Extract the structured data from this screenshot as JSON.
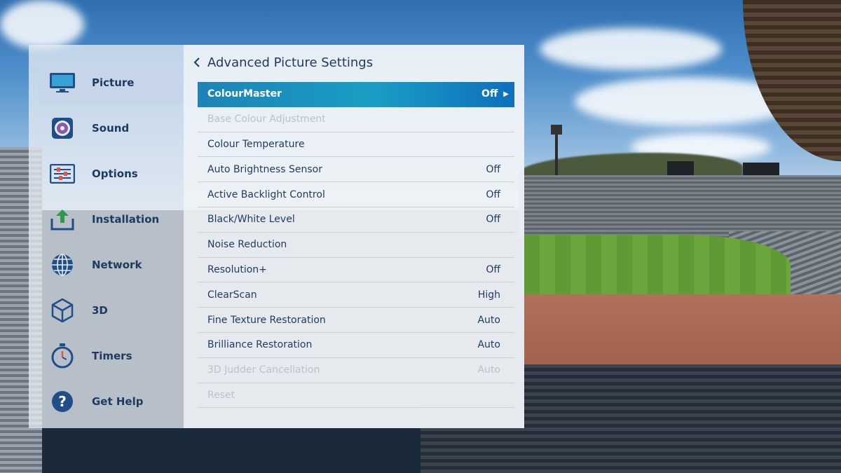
{
  "sidebar": {
    "items": [
      {
        "label": "Picture",
        "icon": "tv-icon",
        "selected": true
      },
      {
        "label": "Sound",
        "icon": "speaker-icon",
        "selected": false
      },
      {
        "label": "Options",
        "icon": "options-icon",
        "selected": false
      },
      {
        "label": "Installation",
        "icon": "installation-icon",
        "selected": false
      },
      {
        "label": "Network",
        "icon": "globe-icon",
        "selected": false
      },
      {
        "label": "3D",
        "icon": "cube-icon",
        "selected": false
      },
      {
        "label": "Timers",
        "icon": "stopwatch-icon",
        "selected": false
      },
      {
        "label": "Get Help",
        "icon": "help-icon",
        "selected": false
      }
    ]
  },
  "header": {
    "back_icon": "chevron-left-icon",
    "title": "Advanced Picture Settings"
  },
  "settings": [
    {
      "label": "ColourMaster",
      "value": "Off",
      "state": "selected"
    },
    {
      "label": "Base Colour Adjustment",
      "value": "",
      "state": "disabled"
    },
    {
      "label": "Colour Temperature",
      "value": "",
      "state": "normal"
    },
    {
      "label": "Auto Brightness Sensor",
      "value": "Off",
      "state": "normal"
    },
    {
      "label": "Active Backlight Control",
      "value": "Off",
      "state": "normal"
    },
    {
      "label": "Black/White Level",
      "value": "Off",
      "state": "normal"
    },
    {
      "label": "Noise Reduction",
      "value": "",
      "state": "normal"
    },
    {
      "label": "Resolution+",
      "value": "Off",
      "state": "normal"
    },
    {
      "label": "ClearScan",
      "value": "High",
      "state": "normal"
    },
    {
      "label": "Fine Texture Restoration",
      "value": "Auto",
      "state": "normal"
    },
    {
      "label": "Brilliance Restoration",
      "value": "Auto",
      "state": "normal"
    },
    {
      "label": "3D Judder Cancellation",
      "value": "Auto",
      "state": "disabled"
    },
    {
      "label": "Reset",
      "value": "",
      "state": "disabled"
    }
  ],
  "colors": {
    "accent": "#1a9ec4",
    "text": "#1e3a5f",
    "disabled_text": "#b8c3cf",
    "icon_blue": "#1f4f86"
  }
}
